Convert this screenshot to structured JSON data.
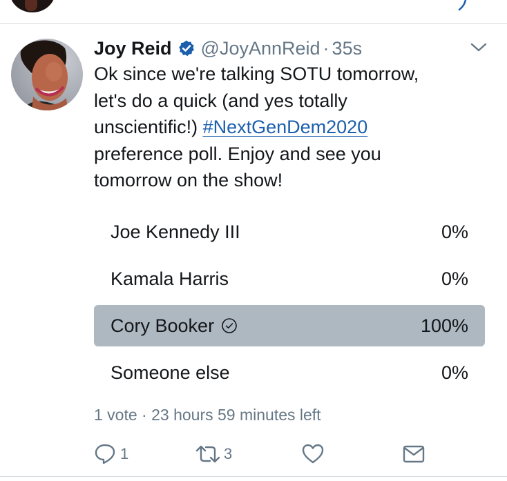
{
  "tweet": {
    "author_name": "Joy Reid",
    "handle": "@JoyAnnReid",
    "separator": "·",
    "time": "35s",
    "text_lines": [
      "Ok since we're talking SOTU tomorrow,",
      "let's do a quick (and yes totally",
      "unscientific!)",
      "preference poll. Enjoy and see you",
      "tomorrow on the show!"
    ],
    "hashtag": "#NextGenDem2020"
  },
  "poll": {
    "options": [
      {
        "label": "Joe Kennedy III",
        "percent": "0%",
        "share": 0,
        "selected": false
      },
      {
        "label": "Kamala Harris",
        "percent": "0%",
        "share": 0,
        "selected": false
      },
      {
        "label": "Cory Booker",
        "percent": "100%",
        "share": 1,
        "selected": true
      },
      {
        "label": "Someone else",
        "percent": "0%",
        "share": 0,
        "selected": false
      }
    ],
    "meta": "1 vote · 23 hours 59 minutes left"
  },
  "actions": {
    "reply_count": "1",
    "retweet_count": "3"
  },
  "colors": {
    "verified": "#1b5fad",
    "link": "#1b5fad",
    "muted": "#657786",
    "poll_fill": "#aeb8c0"
  }
}
